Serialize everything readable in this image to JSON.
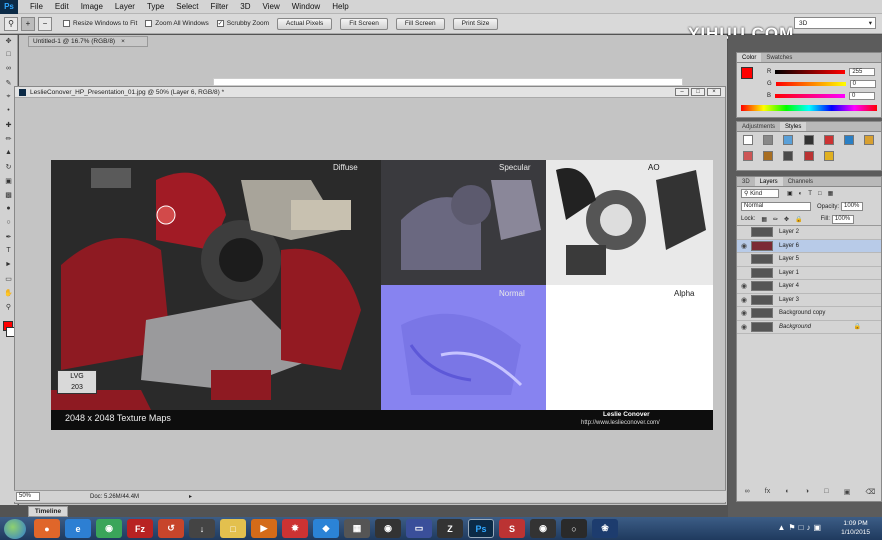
{
  "app": {
    "logo": "Ps"
  },
  "menu": [
    "File",
    "Edit",
    "Image",
    "Layer",
    "Type",
    "Select",
    "Filter",
    "3D",
    "View",
    "Window",
    "Help"
  ],
  "options": {
    "resize_windows": "Resize Windows to Fit",
    "zoom_all_windows": "Zoom All Windows",
    "scrubby_zoom": "Scrubby Zoom",
    "buttons": [
      "Actual Pixels",
      "Fit Screen",
      "Fill Screen",
      "Print Size"
    ],
    "workspace": "3D"
  },
  "watermark": "YIHUU.COM",
  "documents": {
    "tab1": "Untitled-1 @ 16.7% (RGB/8)",
    "active_title": "LeslieConover_HP_Presentation_01.jpg @ 50% (Layer 6, RGB/8) *"
  },
  "texture": {
    "labels": {
      "diffuse": "Diffuse",
      "specular": "Specular",
      "ao": "AO",
      "normal": "Normal",
      "alpha": "Alpha"
    },
    "caption": "2048 x 2048 Texture Maps",
    "badge_line1": "LVG",
    "badge_line2": "203",
    "author": "Leslie Conover",
    "url": "http://www.leslieconover.com/"
  },
  "status": {
    "zoom": "50%",
    "doc": "Doc: 5.26M/44.4M"
  },
  "timeline": "Timeline",
  "color_panel": {
    "tabs": [
      "Color",
      "Swatches"
    ],
    "r_label": "R",
    "g_label": "G",
    "b_label": "B",
    "r": "255",
    "g": "0",
    "b": "0",
    "foreground": "#ff0000"
  },
  "styles_panel": {
    "tabs": [
      "Adjustments",
      "Styles"
    ]
  },
  "layers_panel": {
    "tabs": [
      "3D",
      "Layers",
      "Channels"
    ],
    "kind": "Kind",
    "blend_mode": "Normal",
    "opacity_label": "Opacity:",
    "opacity": "100%",
    "lock_label": "Lock:",
    "fill_label": "Fill:",
    "fill": "100%",
    "layers": [
      {
        "name": "Layer 2",
        "visible": false,
        "selected": false
      },
      {
        "name": "Layer 6",
        "visible": true,
        "selected": true
      },
      {
        "name": "Layer 5",
        "visible": false,
        "selected": false
      },
      {
        "name": "Layer 1",
        "visible": false,
        "selected": false
      },
      {
        "name": "Layer 4",
        "visible": true,
        "selected": false
      },
      {
        "name": "Layer 3",
        "visible": true,
        "selected": false
      },
      {
        "name": "Background copy",
        "visible": true,
        "selected": false
      },
      {
        "name": "Background",
        "visible": true,
        "selected": false
      }
    ]
  },
  "taskbar": {
    "time": "1:09 PM",
    "date": "1/10/2015"
  }
}
